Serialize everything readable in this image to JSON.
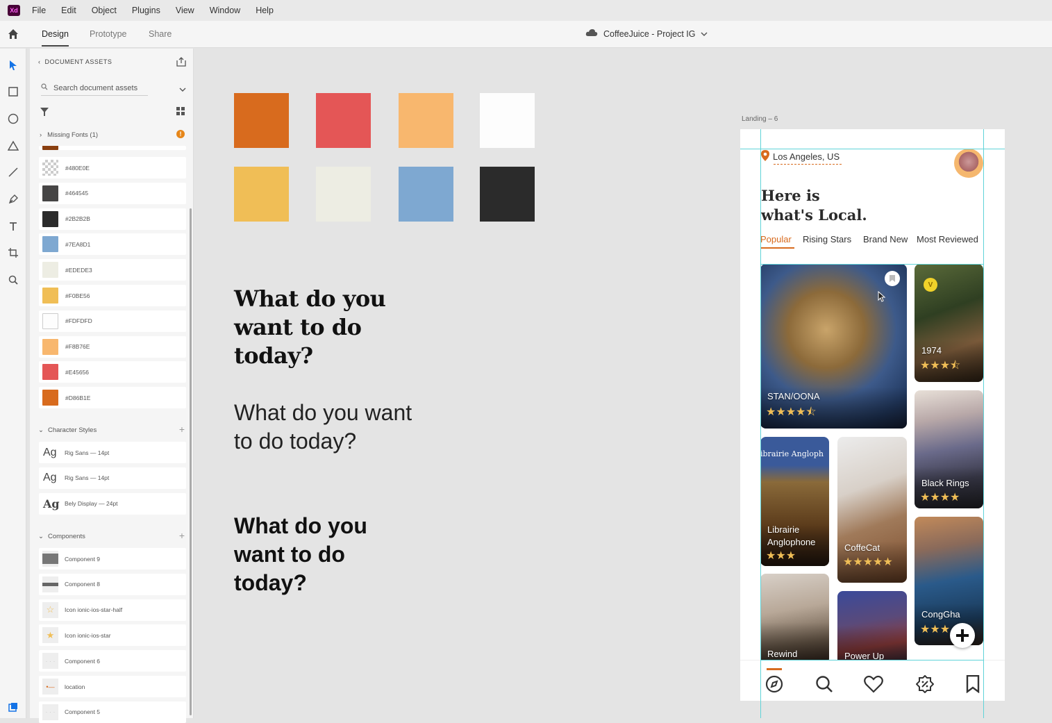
{
  "app": {
    "logo_text": "Xd",
    "menu": [
      "File",
      "Edit",
      "Object",
      "Plugins",
      "View",
      "Window",
      "Help"
    ],
    "modes": [
      "Design",
      "Prototype",
      "Share"
    ],
    "active_mode": "Design",
    "document_title": "CoffeeJuice - Project IG"
  },
  "assets_panel": {
    "header": "DOCUMENT ASSETS",
    "search_placeholder": "Search document assets",
    "missing_fonts": "Missing Fonts (1)",
    "colors": [
      {
        "label": "#480E0E",
        "hex": "#480E0E",
        "style": "checker"
      },
      {
        "label": "#464545",
        "hex": "#464545"
      },
      {
        "label": "#2B2B2B",
        "hex": "#2B2B2B"
      },
      {
        "label": "#7EA8D1",
        "hex": "#7EA8D1"
      },
      {
        "label": "#EDEDE3",
        "hex": "#EDEDE3"
      },
      {
        "label": "#F0BE56",
        "hex": "#F0BE56"
      },
      {
        "label": "#FDFDFD",
        "hex": "#FDFDFD",
        "style": "white"
      },
      {
        "label": "#F8B76E",
        "hex": "#F8B76E"
      },
      {
        "label": "#E45656",
        "hex": "#E45656"
      },
      {
        "label": "#D86B1E",
        "hex": "#D86B1E"
      }
    ],
    "character_styles_title": "Character Styles",
    "character_styles": [
      {
        "glyph": "Ag",
        "label": "Rig Sans — 14pt"
      },
      {
        "glyph": "Ag",
        "label": "Rig Sans — 14pt"
      },
      {
        "glyph": "Ag",
        "label": "Bely Display — 24pt"
      }
    ],
    "components_title": "Components",
    "components": [
      {
        "label": "Component 9",
        "icon": "gray-bar-thumb"
      },
      {
        "label": "Component 8",
        "icon": "line-thumb"
      },
      {
        "label": "Icon ionic-ios-star-half",
        "icon": "star-half-icon"
      },
      {
        "label": "Icon ionic-ios-star",
        "icon": "star-icon"
      },
      {
        "label": "Component 6",
        "icon": "dots-thumb"
      },
      {
        "label": "location",
        "icon": "location-thumb"
      },
      {
        "label": "Component 5",
        "icon": "dots-thumb"
      }
    ]
  },
  "canvas": {
    "palette": [
      "#D86B1E",
      "#E45656",
      "#F8B76E",
      "#FDFDFD",
      "#F0BE56",
      "#EDEDE3",
      "#7EA8D1",
      "#2B2B2B"
    ],
    "sample_text": "What do you want to do today?"
  },
  "artboard": {
    "label": "Landing – 6",
    "location": "Los Angeles, US",
    "headline_line1": "Here is",
    "headline_line2": "what's Local.",
    "tabs": [
      "Popular",
      "Rising Stars",
      "Brand New",
      "Most Reviewed"
    ],
    "active_tab": "Popular",
    "cards": [
      {
        "name": "STAN/OONA",
        "rating": 4.5,
        "stars": "★★★★⯪"
      },
      {
        "name": "1974",
        "rating": 3.5,
        "stars": "★★★⯪"
      },
      {
        "name": "Black Rings",
        "rating": 4,
        "stars": "★★★★"
      },
      {
        "name": "Librairie Anglophone",
        "sign": "ibrairie Angloph",
        "rating": 3,
        "stars": "★★★"
      },
      {
        "name": "CoffeCat",
        "rating": 5,
        "stars": "★★★★★"
      },
      {
        "name": "CongGha",
        "rating": 3,
        "stars": "★★★"
      },
      {
        "name": "Rewind"
      },
      {
        "name": "Power Up"
      }
    ],
    "badge_text": "V",
    "nav": [
      "compass-icon",
      "search-icon",
      "heart-icon",
      "discount-icon",
      "bookmark-icon"
    ]
  }
}
